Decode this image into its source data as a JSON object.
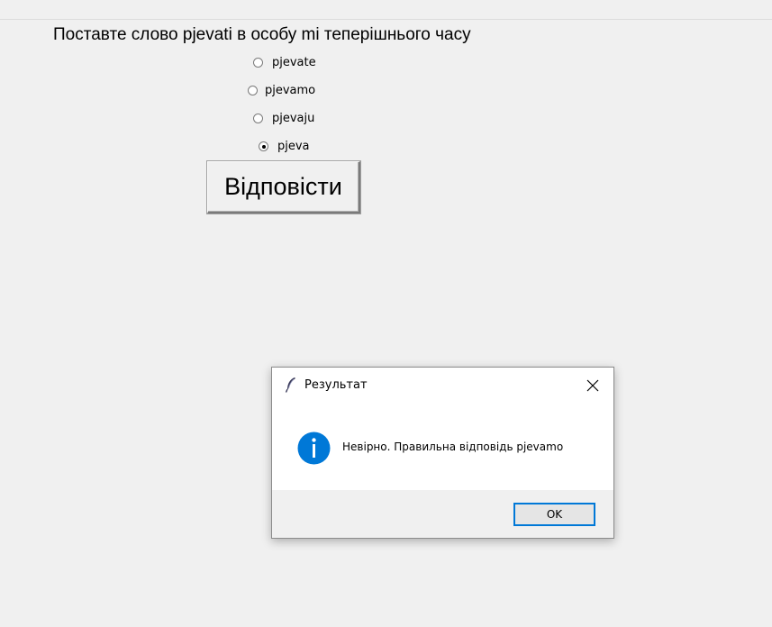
{
  "question": "Поставте слово pjevati в особу mi теперішнього часу",
  "options": [
    {
      "label": "pjevate",
      "checked": false
    },
    {
      "label": "pjevamo",
      "checked": false
    },
    {
      "label": "pjevaju",
      "checked": false
    },
    {
      "label": "pjeva",
      "checked": true
    }
  ],
  "answer_button": "Відповісти",
  "dialog": {
    "title": "Результат",
    "message": "Невірно. Правильна відповідь pjevamo",
    "ok_label": "OK",
    "accent": "#0078d7",
    "icon": "info-icon",
    "title_icon": "feather-icon"
  }
}
